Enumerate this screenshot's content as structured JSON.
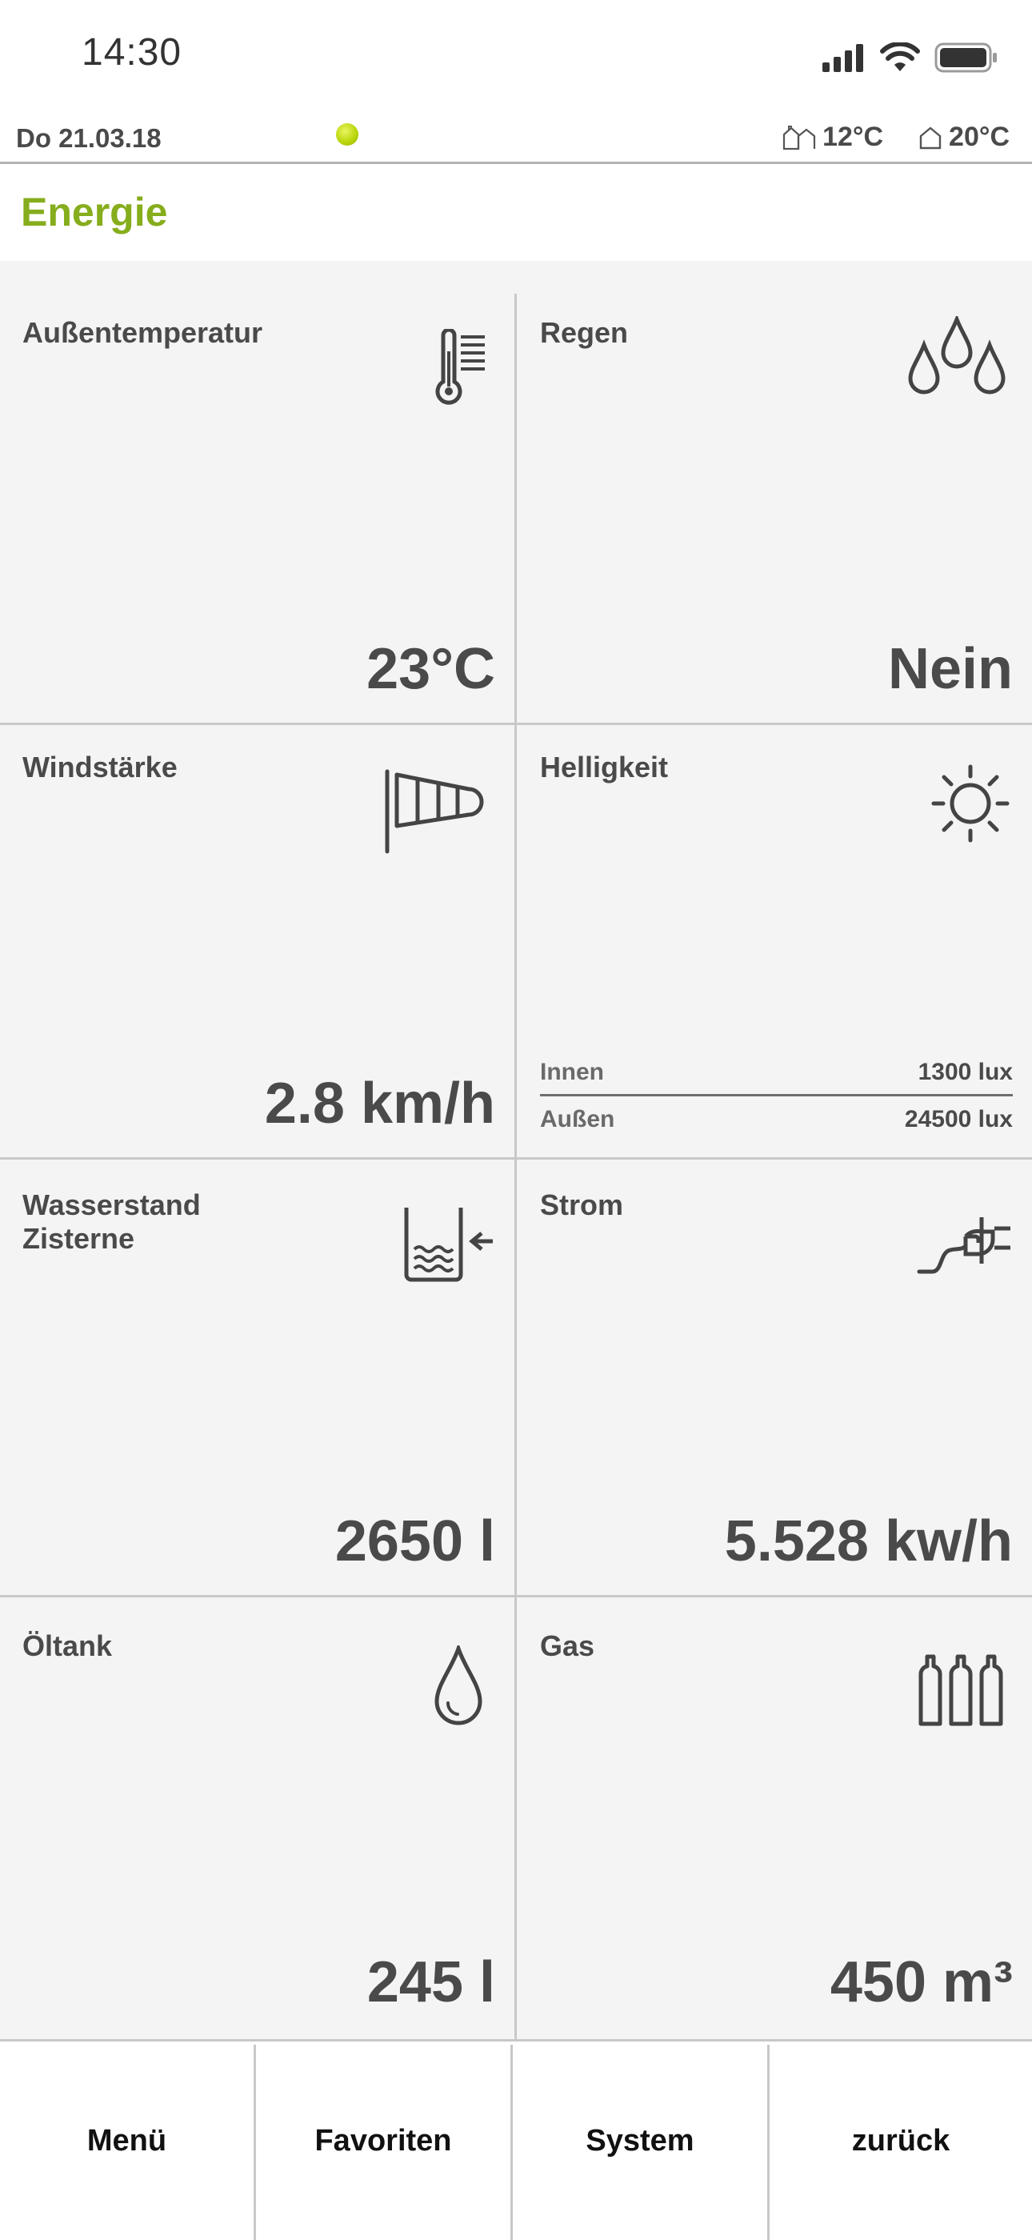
{
  "status_bar": {
    "time": "14:30"
  },
  "info_bar": {
    "date": "Do 21.03.18",
    "outdoor_temp": "12°C",
    "indoor_temp": "20°C",
    "status_dot_color": "#bcd70c"
  },
  "page": {
    "title": "Energie",
    "title_color": "#86ad1c"
  },
  "tiles": [
    {
      "label": "Außentemperatur",
      "value": "23°C",
      "icon": "thermometer-icon"
    },
    {
      "label": "Regen",
      "value": "Nein",
      "icon": "raindrops-icon"
    },
    {
      "label": "Windstärke",
      "value": "2.8 km/h",
      "icon": "windsock-icon"
    },
    {
      "label": "Helligkeit",
      "icon": "sun-icon",
      "rows": [
        {
          "label": "Innen",
          "value": "1300 lux"
        },
        {
          "label": "Außen",
          "value": "24500 lux"
        }
      ]
    },
    {
      "label": "Wasserstand\nZisterne",
      "value": "2650 l",
      "icon": "water-tank-icon"
    },
    {
      "label": "Strom",
      "value": "5.528 kw/h",
      "icon": "power-plug-icon"
    },
    {
      "label": "Öltank",
      "value": "245 l",
      "icon": "oil-drop-icon"
    },
    {
      "label": "Gas",
      "value": "450 m³",
      "icon": "gas-bottles-icon"
    }
  ],
  "bottom_nav": [
    {
      "label": "Menü"
    },
    {
      "label": "Favoriten"
    },
    {
      "label": "System"
    },
    {
      "label": "zurück"
    }
  ]
}
